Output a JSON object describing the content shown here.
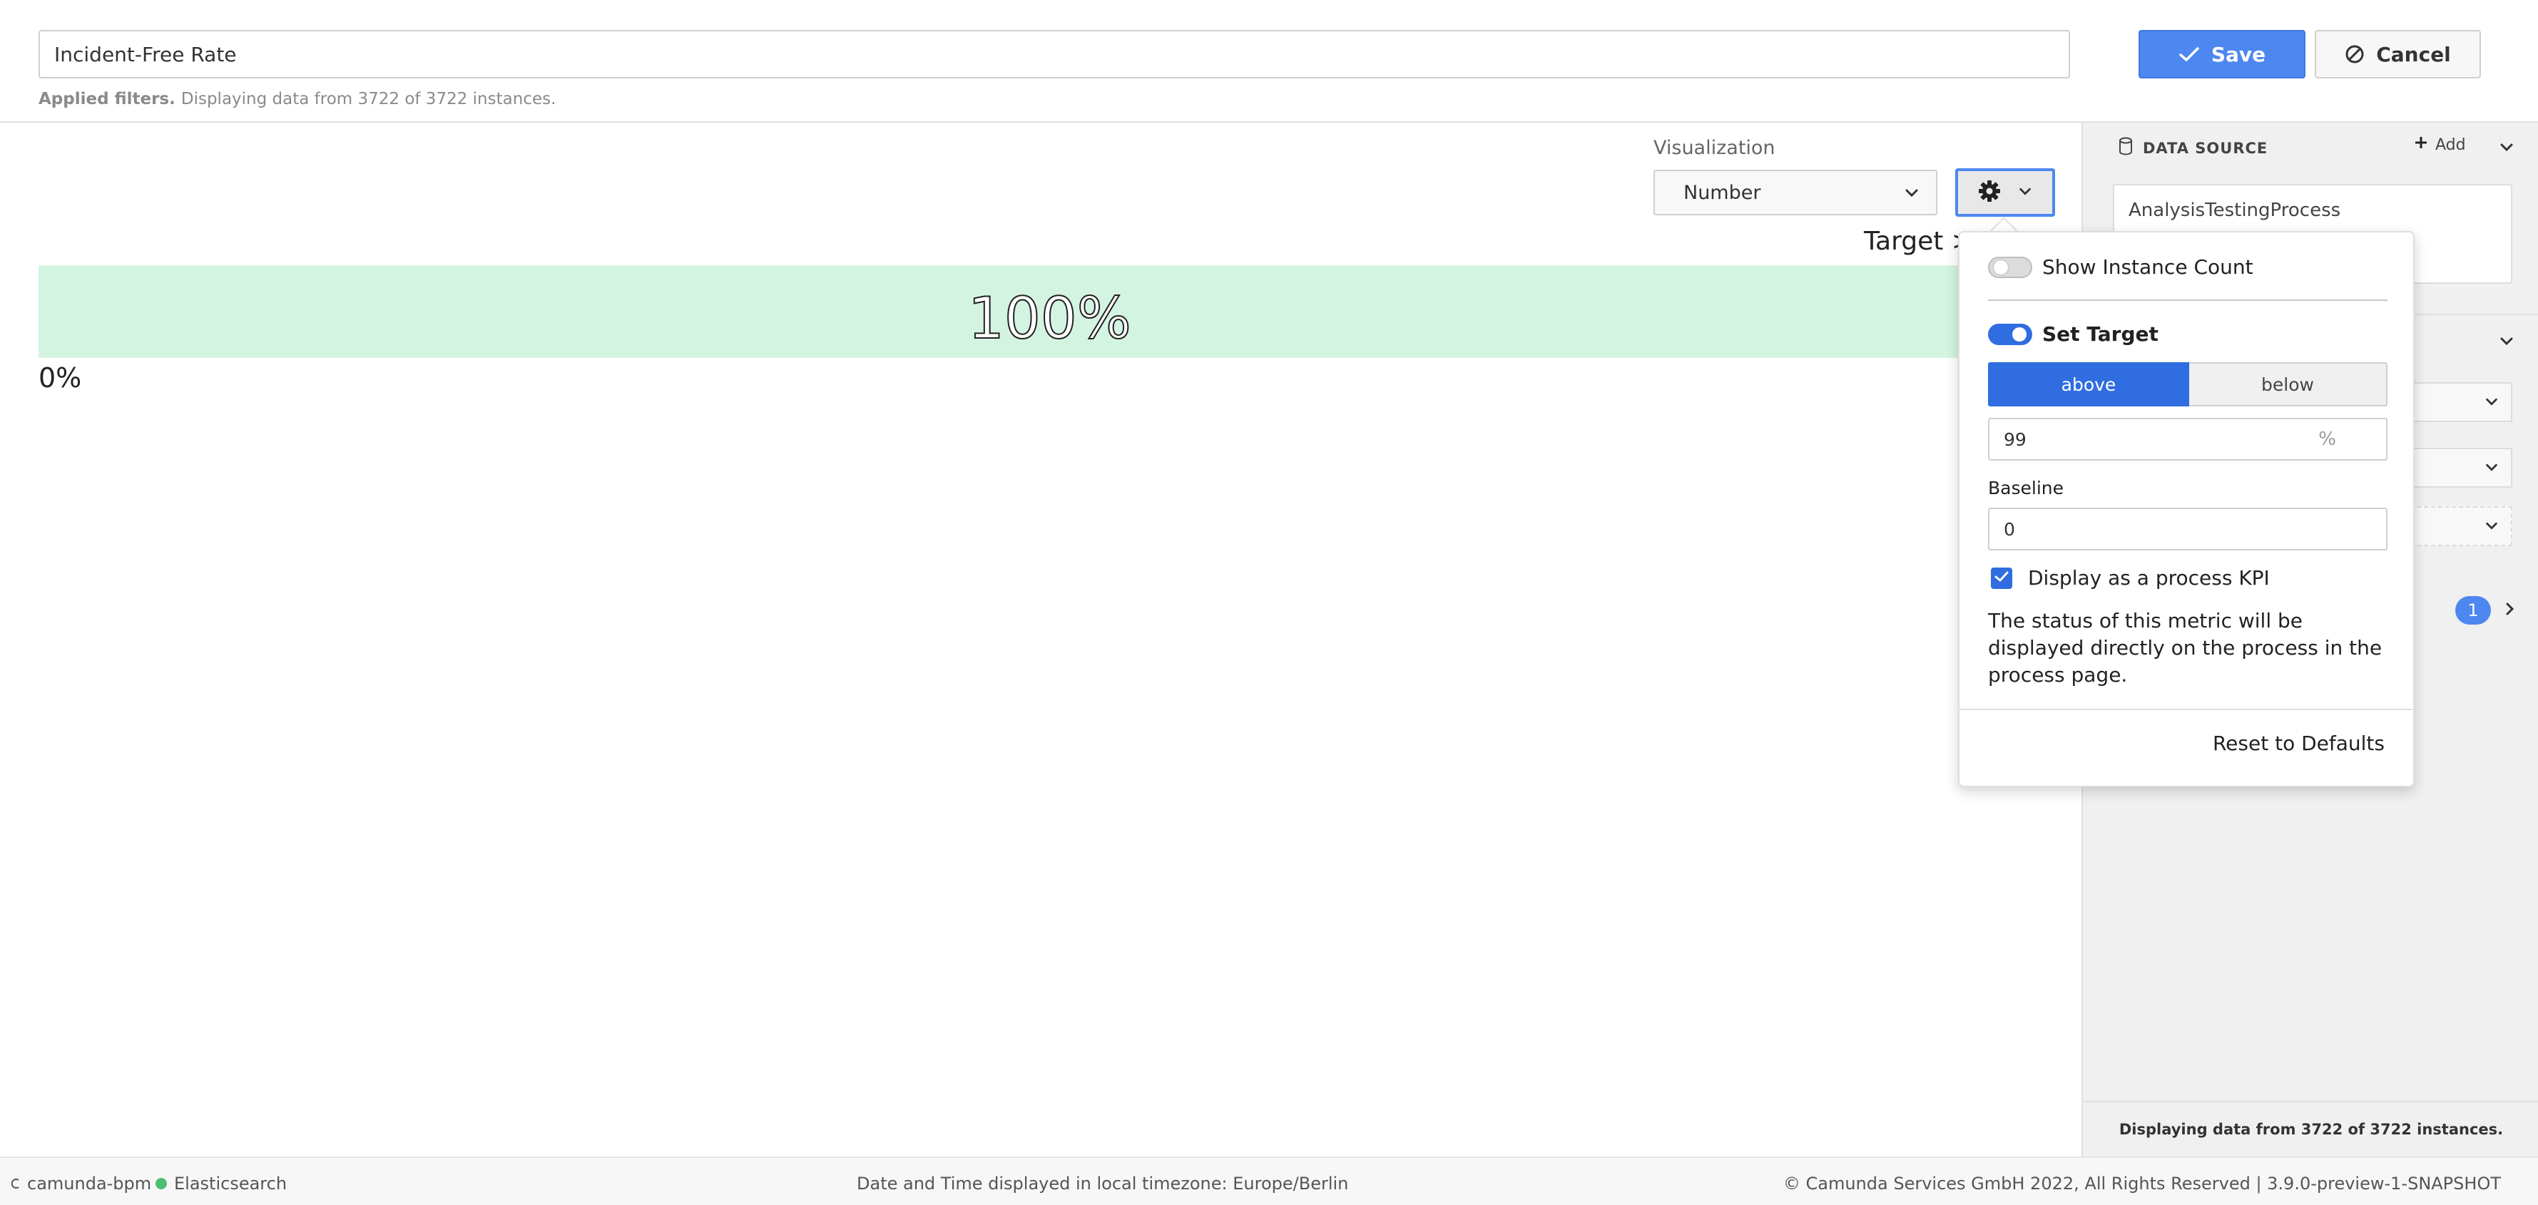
{
  "header": {
    "report_name": "Incident-Free Rate",
    "filters_label": "Applied filters.",
    "filters_text": "Displaying data from 3722 of 3722 instances.",
    "save_label": "Save",
    "cancel_label": "Cancel"
  },
  "main": {
    "visualization_label": "Visualization",
    "visualization_value": "Number",
    "target_text": "Target >",
    "value": "100%",
    "baseline_label": "0%",
    "progress_fraction": 1.0,
    "bar_color": "#d4f4e2"
  },
  "sidebar": {
    "data_source_heading": "DATA SOURCE",
    "add_label": "Add",
    "process_name": "AnalysisTestingProcess",
    "filter_count": "1",
    "footer_text": "Displaying data from 3722 of 3722 instances."
  },
  "popover": {
    "show_instance_count_label": "Show Instance Count",
    "show_instance_count_on": false,
    "set_target_label": "Set Target",
    "set_target_on": true,
    "above_label": "above",
    "below_label": "below",
    "target_value": "99",
    "target_unit": "%",
    "baseline_label": "Baseline",
    "baseline_value": "0",
    "kpi_label": "Display as a process KPI",
    "kpi_checked": true,
    "kpi_description": "The status of this metric will be displayed directly on the process in the process page.",
    "reset_label": "Reset to Defaults"
  },
  "footer": {
    "engine_name": "camunda-bpm",
    "db_name": "Elasticsearch",
    "timezone_text": "Date and Time displayed in local timezone: Europe/Berlin",
    "copyright_text": "© Camunda Services GmbH 2022, All Rights Reserved | 3.9.0-preview-1-SNAPSHOT"
  },
  "colors": {
    "accent": "#4d87f0",
    "toggle_on": "#2f6de0",
    "status_ok": "#4cbf73"
  },
  "icons": [
    "check-icon",
    "cancel-circle-icon",
    "chevron-down-icon",
    "gear-icon",
    "database-icon",
    "plus-icon",
    "chevron-right-icon",
    "checkbox-check-icon",
    "engine-icon"
  ]
}
